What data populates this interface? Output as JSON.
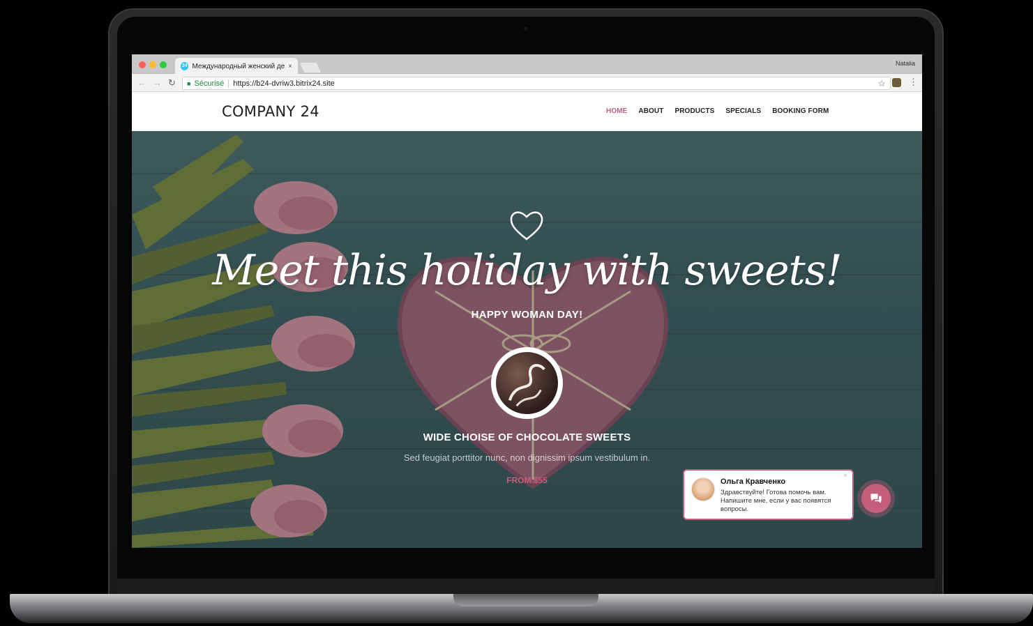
{
  "browser": {
    "tab_title": "Международный женский де",
    "tab_favicon_text": "24",
    "profile_name": "Natalia",
    "secure_label": "Sécurisé",
    "url": "https://b24-dvriw3.bitrix24.site"
  },
  "site": {
    "logo": "COMPANY 24",
    "nav": [
      {
        "label": "HOME",
        "active": true
      },
      {
        "label": "ABOUT",
        "active": false
      },
      {
        "label": "PRODUCTS",
        "active": false
      },
      {
        "label": "SPECIALS",
        "active": false
      },
      {
        "label": "BOOKING FORM",
        "active": false
      }
    ]
  },
  "hero": {
    "title": "Meet this holiday with sweets!",
    "subtitle": "HAPPY WOMAN DAY!",
    "product_title": "WIDE CHOISE OF CHOCOLATE SWEETS",
    "product_desc": "Sed feugiat porttitor nunc, non dignissim ipsum vestibulum in.",
    "product_price": "FROM $55"
  },
  "chat": {
    "name": "Ольга Кравченко",
    "message": "Здравствуйте! Готова помочь вам. Напишите мне, если у вас появятся вопросы.",
    "close": "×"
  },
  "colors": {
    "accent": "#c55e7b",
    "hero_bg": "#46686a"
  }
}
